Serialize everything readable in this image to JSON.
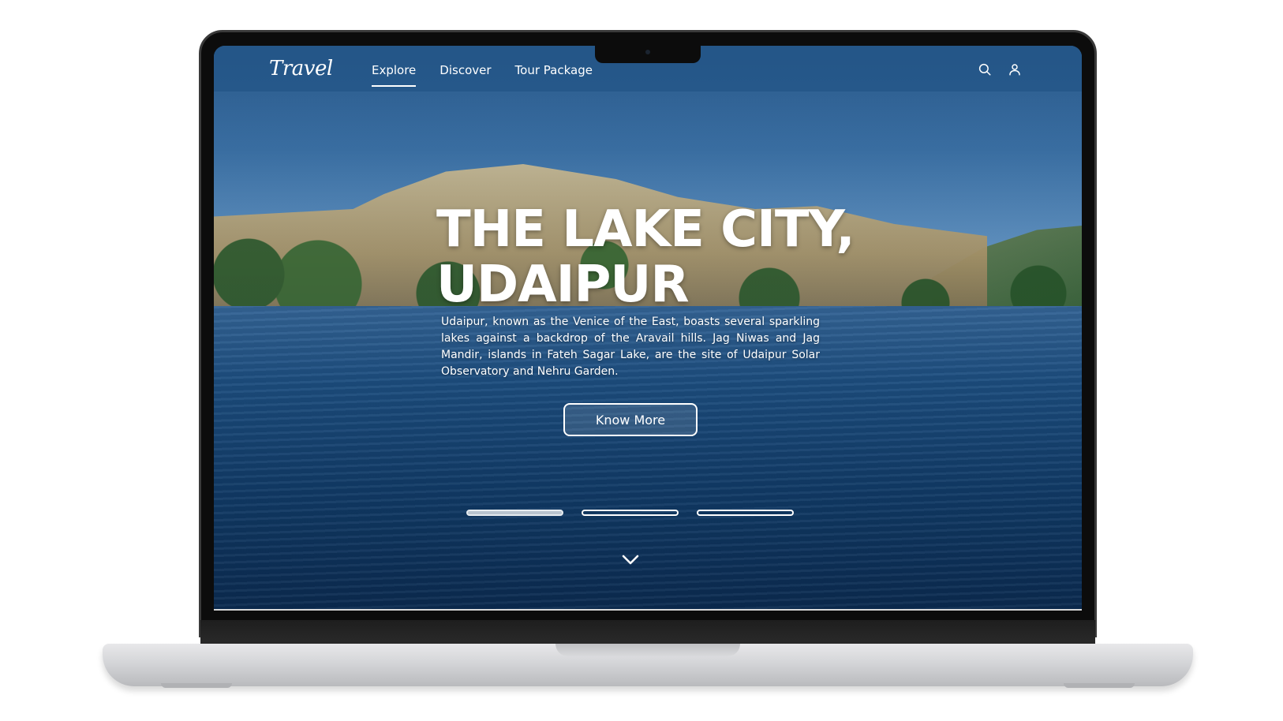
{
  "app": {
    "logo_text": "Travel"
  },
  "nav": {
    "links": [
      {
        "label": "Explore",
        "active": true
      },
      {
        "label": "Discover",
        "active": false
      },
      {
        "label": "Tour Package",
        "active": false
      }
    ],
    "icons": [
      "search-icon",
      "user-icon"
    ]
  },
  "hero": {
    "title_line1": "THE LAKE CITY,",
    "title_line2": "UDAIPUR",
    "description": "Udaipur, known as the Venice of the East, boasts several sparkling lakes against a backdrop of the Aravail hills. Jag Niwas and Jag Mandir, islands in Fateh Sagar Lake, are the site of Udaipur Solar Observatory and Nehru Garden.",
    "button_label": "Know More"
  },
  "slider": {
    "count": 3,
    "active_index": 0
  },
  "colors": {
    "nav_bg": "#235587",
    "text": "#ffffff",
    "water": "#123f6d"
  }
}
